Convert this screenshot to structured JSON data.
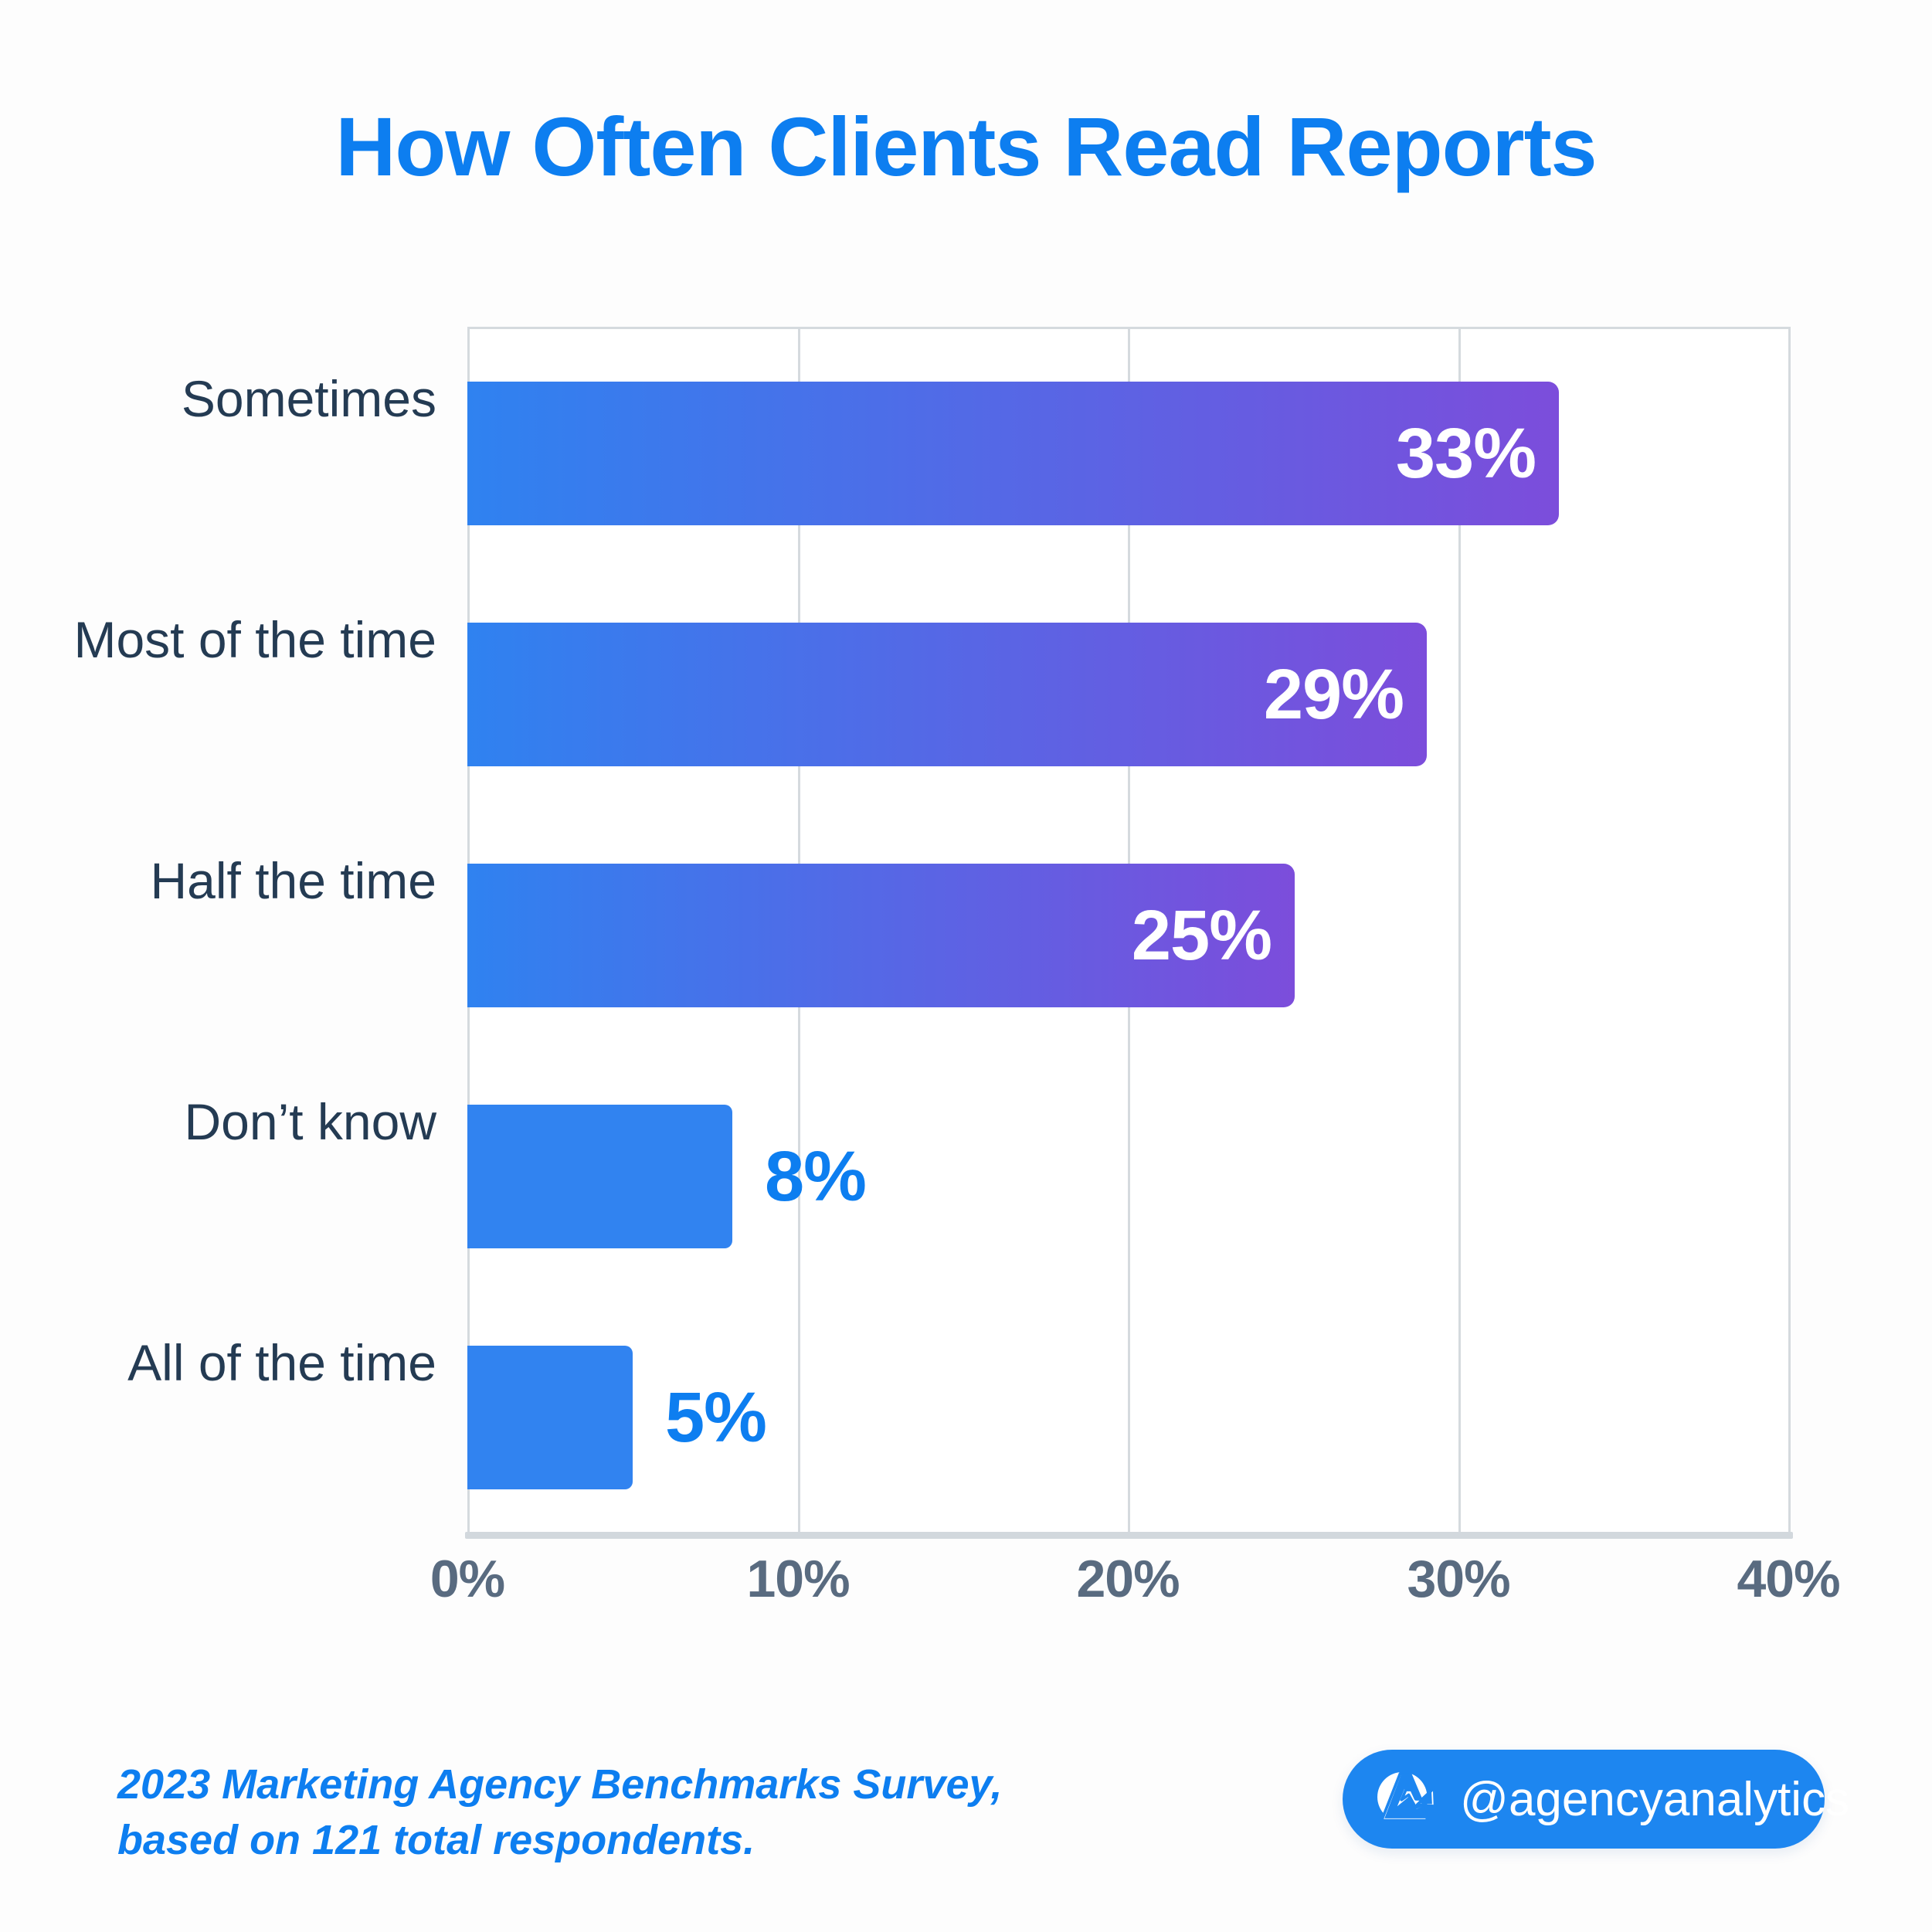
{
  "title": "How Often Clients Read Reports",
  "colors": {
    "title": "#0d7ef0",
    "bar_start": "#2f82f0",
    "bar_end": "#7c4ddb",
    "bar_short": "#3183f0",
    "category_label": "#243b53",
    "tick_label": "#596b80",
    "grid": "#d5dade",
    "badge": "#1d86f0",
    "background": "#fdfdfd"
  },
  "footer": {
    "source": "2023 Marketing Agency Benchmarks Survey,\nbased on 121 total respondents.",
    "brand_handle": "@agencyanalytics",
    "brand_logo_icon": "agencyanalytics-logo-icon"
  },
  "chart_data": {
    "type": "bar",
    "orientation": "horizontal",
    "title": "How Often Clients Read Reports",
    "xlabel": "",
    "ylabel": "",
    "xlim": [
      0,
      40
    ],
    "grid": true,
    "legend": false,
    "categories": [
      "Sometimes",
      "Most of the time",
      "Half the time",
      "Don’t know",
      "All of the time"
    ],
    "values": [
      33,
      29,
      25,
      8,
      5
    ],
    "value_labels": [
      "33%",
      "29%",
      "25%",
      "8%",
      "5%"
    ],
    "label_placement": [
      "inside",
      "inside",
      "inside",
      "outside",
      "outside"
    ],
    "xticks": [
      0,
      10,
      20,
      30,
      40
    ],
    "xtick_labels": [
      "0%",
      "10%",
      "20%",
      "30%",
      "40%"
    ]
  }
}
